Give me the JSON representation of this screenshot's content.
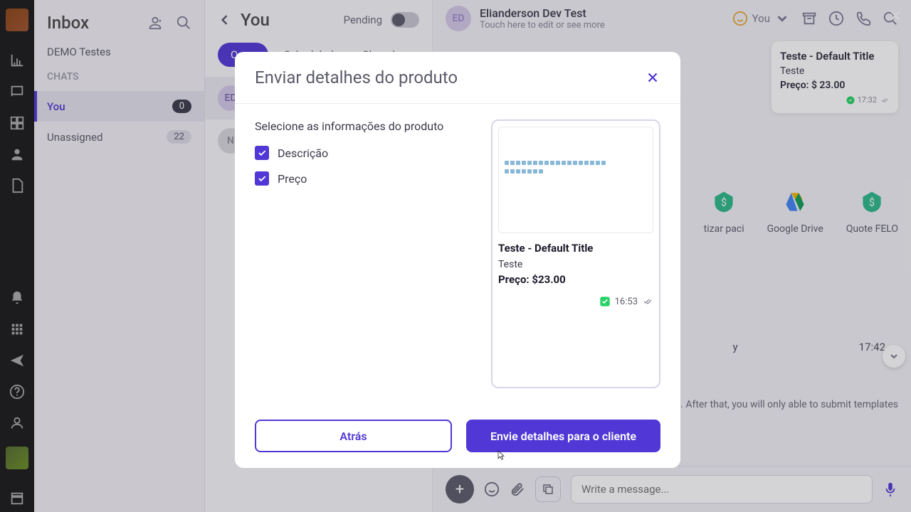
{
  "rail": {},
  "inbox": {
    "title": "Inbox",
    "sub": "DEMO Testes",
    "chats_label": "CHATS",
    "you": "You",
    "you_count": "0",
    "unassigned": "Unassigned",
    "unassigned_count": "22"
  },
  "conv": {
    "title": "You",
    "pending": "Pending",
    "tabs": {
      "open": "Open",
      "scheduled": "Scheduled",
      "closed": "Closed"
    },
    "items": [
      {
        "initials": "ED"
      },
      {
        "initials": "N"
      }
    ]
  },
  "chat": {
    "header": {
      "initials": "ED",
      "name": "Elianderson Dev Test",
      "sub": "Touch here to edit or see more",
      "you": "You"
    },
    "card": {
      "title": "Teste - Default Title",
      "desc": "Teste",
      "price_label": "Preço:",
      "price_value": "$ 23.00",
      "time": "17:32"
    },
    "features": [
      {
        "label": "tizar paci"
      },
      {
        "label": "Google Drive"
      },
      {
        "label": "Quote FELO"
      }
    ],
    "row_label_y": "y",
    "row_time": "17:42",
    "info": "tations. After that, you will only able to submit templates",
    "composer_placeholder": "Write a message..."
  },
  "modal": {
    "title": "Enviar detalhes do produto",
    "subtitle": "Selecione as informações do produto",
    "checks": {
      "descricao": "Descrição",
      "preco": "Preço"
    },
    "preview": {
      "title": "Teste - Default Title",
      "desc": "Teste",
      "price_label": "Preço:",
      "price_value": "$23.00",
      "time": "16:53"
    },
    "back": "Atrás",
    "send": "Envie detalhes para o cliente"
  }
}
